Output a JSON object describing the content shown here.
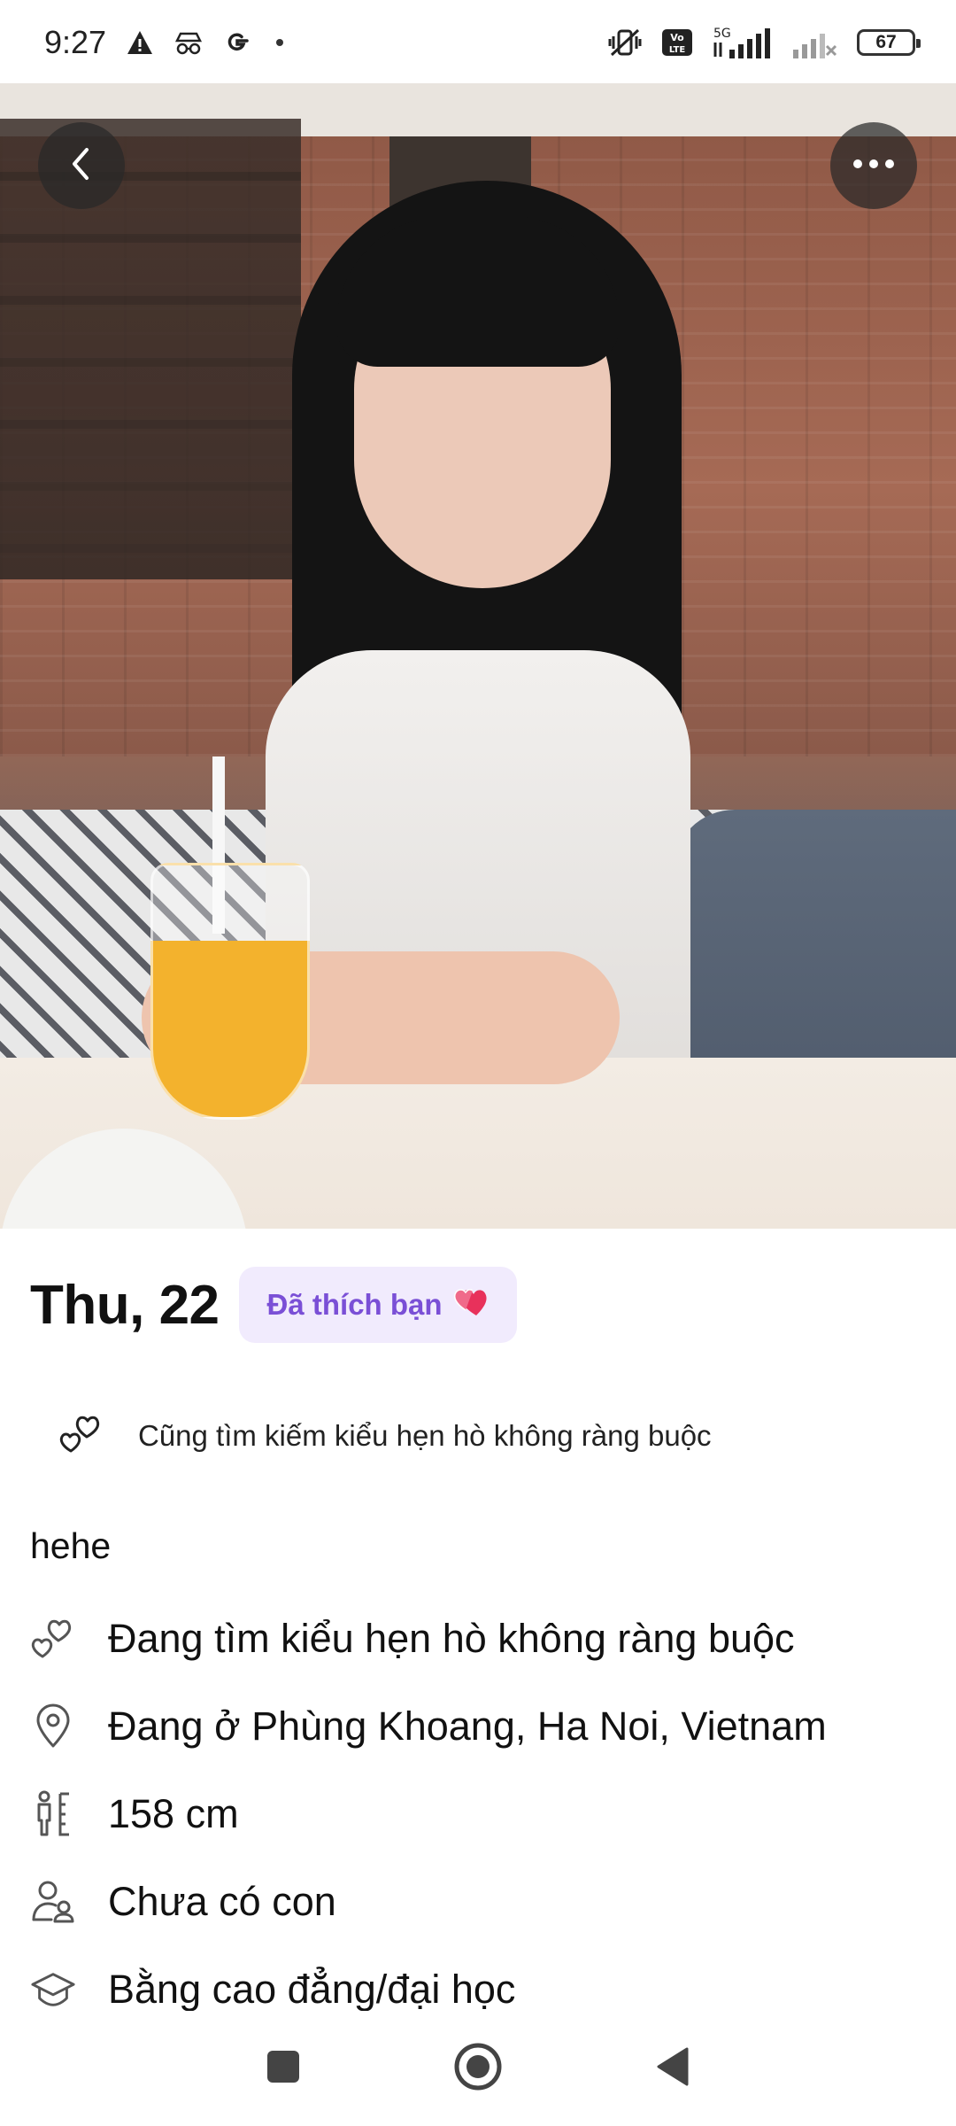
{
  "status_bar": {
    "time": "9:27",
    "battery": "67",
    "network": "5G",
    "volte": "Vo LTE",
    "icons": [
      "warning-icon",
      "incognito-icon",
      "google-icon",
      "vibrate-off-icon",
      "volte-icon",
      "signal-icon",
      "signal-icon-2",
      "battery-icon"
    ]
  },
  "photo": {
    "description_icons": [
      "chevron-left-icon",
      "more-horizontal-icon"
    ]
  },
  "profile": {
    "name_age": "Thu, 22",
    "liked_badge": "Đã thích bạn",
    "liked_badge_icon": "hearts-icon",
    "also_looking": "Cũng tìm kiếm kiểu hẹn hò không ràng buộc",
    "bio": "hehe",
    "details": [
      {
        "icon": "hearts-outline-icon",
        "text": "Đang tìm kiểu hẹn hò không ràng buộc"
      },
      {
        "icon": "location-pin-icon",
        "text": "Đang ở Phùng Khoang, Ha Noi, Vietnam"
      },
      {
        "icon": "height-icon",
        "text": "158 cm"
      },
      {
        "icon": "children-icon",
        "text": "Chưa có con"
      },
      {
        "icon": "education-cap-icon",
        "text": "Bằng cao đẳng/đại học"
      }
    ]
  },
  "nav": {
    "buttons": [
      "recents-button",
      "home-button",
      "back-button"
    ]
  },
  "colors": {
    "accent": "#7a4fd6",
    "badge_bg": "#f1ebfd",
    "heart": "#e8315b"
  }
}
